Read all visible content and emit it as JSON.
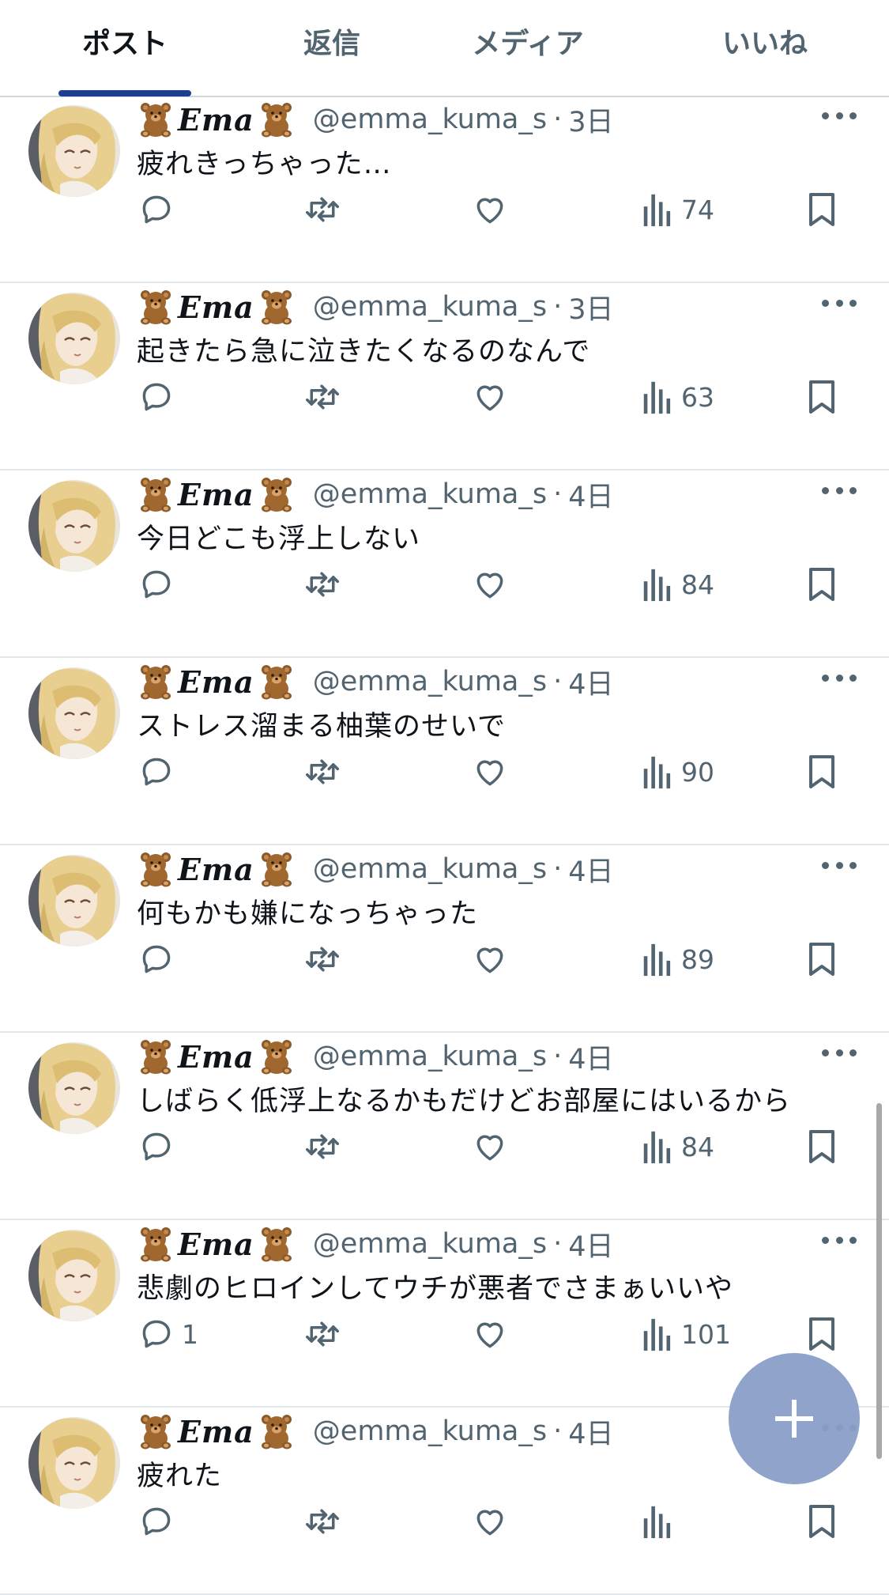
{
  "tabs": [
    {
      "label": "ポスト",
      "active": true
    },
    {
      "label": "返信",
      "active": false
    },
    {
      "label": "メディア",
      "active": false
    },
    {
      "label": "いいね",
      "active": false
    }
  ],
  "user": {
    "display_name": "Ema",
    "bear_emoji_icon": "teddy-bear-icon",
    "handle": "@emma_kuma_s",
    "separator": "·"
  },
  "posts": [
    {
      "time": "3日",
      "text": "疲れきっちゃった…",
      "replies": "",
      "views": "74"
    },
    {
      "time": "3日",
      "text": "起きたら急に泣きたくなるのなんで",
      "replies": "",
      "views": "63"
    },
    {
      "time": "4日",
      "text": "今日どこも浮上しない",
      "replies": "",
      "views": "84"
    },
    {
      "time": "4日",
      "text": "ストレス溜まる柚葉のせいで",
      "replies": "",
      "views": "90"
    },
    {
      "time": "4日",
      "text": "何もかも嫌になっちゃった",
      "replies": "",
      "views": "89"
    },
    {
      "time": "4日",
      "text": "しばらく低浮上なるかもだけどお部屋にはいるから",
      "replies": "",
      "views": "84"
    },
    {
      "time": "4日",
      "text": "悲劇のヒロインしてウチが悪者でさまぁいいや",
      "replies": "1",
      "views": "101"
    },
    {
      "time": "4日",
      "text": "疲れた",
      "replies": "",
      "views": ""
    }
  ],
  "colors": {
    "accent": "#1d3f8f",
    "icon_gray": "#536471",
    "fab": "#8a9fc9"
  },
  "icons": [
    "reply-icon",
    "retweet-icon",
    "like-icon",
    "views-icon",
    "bookmark-icon",
    "more-icon",
    "compose-plus-icon"
  ]
}
